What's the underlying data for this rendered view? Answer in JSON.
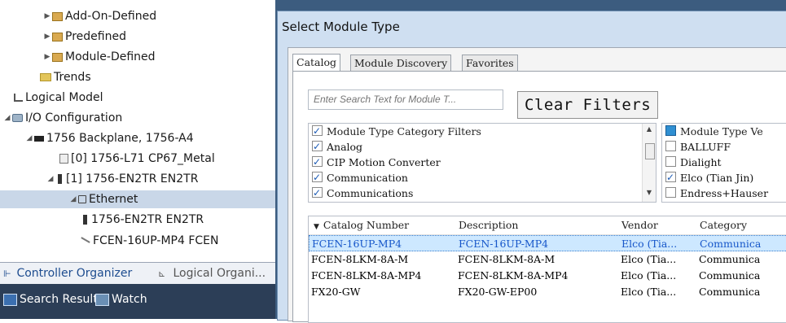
{
  "tree": {
    "items": [
      {
        "label": "Add-On-Defined",
        "icon": "folder-icon"
      },
      {
        "label": "Predefined",
        "icon": "folder-icon"
      },
      {
        "label": "Module-Defined",
        "icon": "folder-icon"
      },
      {
        "label": "Trends",
        "icon": "trends-icon"
      },
      {
        "label": "Logical Model",
        "icon": "logical-model-icon"
      },
      {
        "label": "I/O Configuration",
        "icon": "io-config-icon"
      },
      {
        "label": "1756 Backplane, 1756-A4",
        "icon": "backplane-icon"
      },
      {
        "label": "[0] 1756-L71 CP67_Metal",
        "icon": "controller-icon"
      },
      {
        "label": "[1] 1756-EN2TR EN2TR",
        "icon": "module-icon"
      },
      {
        "label": "Ethernet",
        "icon": "ethernet-icon"
      },
      {
        "label": "1756-EN2TR EN2TR",
        "icon": "module-icon"
      },
      {
        "label": "FCEN-16UP-MP4 FCEN",
        "icon": "device-icon"
      }
    ]
  },
  "tabs_bottom": {
    "controller": "Controller Organizer",
    "logical": "Logical Organi..."
  },
  "bottom_bar": {
    "search_results": "Search Results",
    "watch": "Watch"
  },
  "dialog": {
    "title": "Select Module Type",
    "tabs": [
      "Catalog",
      "Module Discovery",
      "Favorites"
    ],
    "search_placeholder": "Enter Search Text for Module T...",
    "clear_filters": "Clear Filters",
    "category_filters": {
      "header": "Module Type Category Filters",
      "items": [
        "Analog",
        "CIP Motion Converter",
        "Communication",
        "Communications"
      ]
    },
    "vendor_filters": {
      "header": "Module Type Ve",
      "items": [
        "BALLUFF",
        "Dialight",
        "Elco (Tian Jin)",
        "Endress+Hauser"
      ]
    },
    "grid": {
      "columns": [
        "Catalog Number",
        "Description",
        "Vendor",
        "Category"
      ],
      "rows": [
        [
          "FCEN-16UP-MP4",
          "FCEN-16UP-MP4",
          "Elco (Tia...",
          "Communica"
        ],
        [
          "FCEN-8LKM-8A-M",
          "FCEN-8LKM-8A-M",
          "Elco (Tia...",
          "Communica"
        ],
        [
          "FCEN-8LKM-8A-MP4",
          "FCEN-8LKM-8A-MP4",
          "Elco (Tia...",
          "Communica"
        ],
        [
          "FX20-GW",
          "FX20-GW-EP00",
          "Elco (Tia...",
          "Communica"
        ]
      ]
    }
  },
  "colors": {
    "selection": "#c9d7e8",
    "dialog_frame": "#cfdff1",
    "desktop": "#3c5c7f",
    "bottom_bar": "#2c3e57",
    "grid_selection": "#cde8ff",
    "check": "#1c5bb5"
  }
}
